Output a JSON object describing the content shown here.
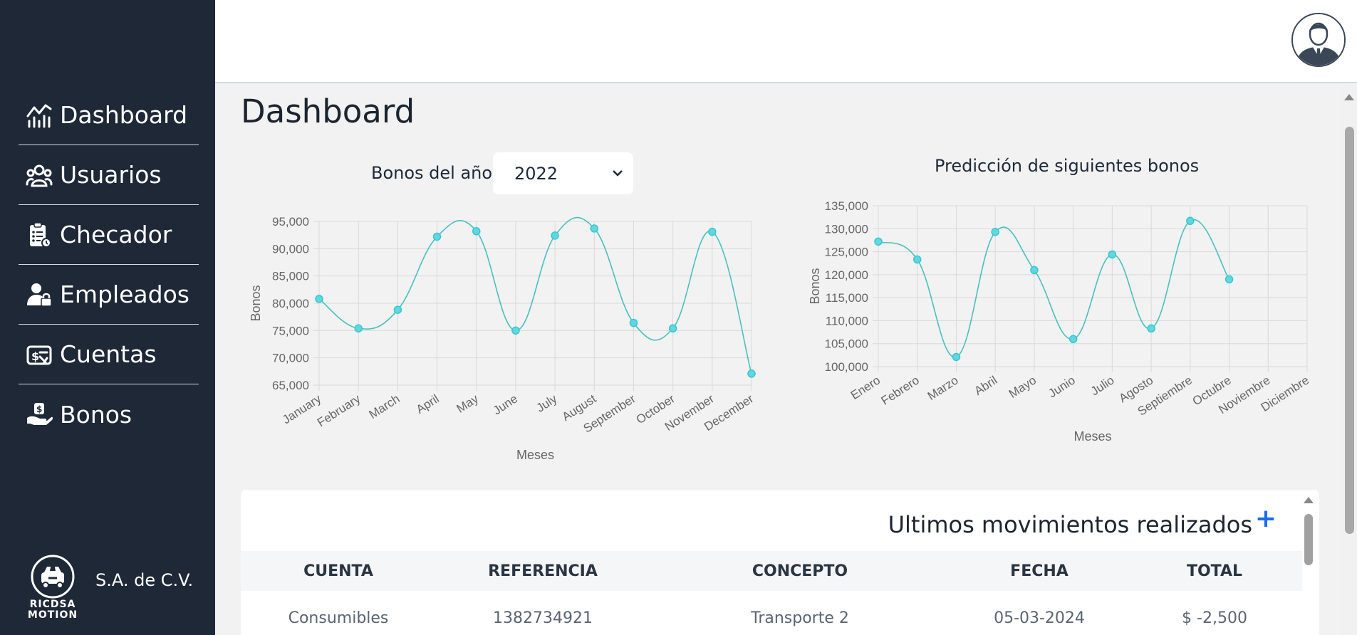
{
  "sidebar": {
    "items": [
      {
        "label": "Dashboard",
        "icon": "dashboard-chart-icon"
      },
      {
        "label": "Usuarios",
        "icon": "users-icon"
      },
      {
        "label": "Checador",
        "icon": "clipboard-check-icon"
      },
      {
        "label": "Empleados",
        "icon": "employee-lock-icon"
      },
      {
        "label": "Cuentas",
        "icon": "money-check-icon"
      },
      {
        "label": "Bonos",
        "icon": "hand-money-icon"
      }
    ],
    "brand_logo_text": [
      "RICDSA",
      "MOTION"
    ],
    "company_suffix": "S.A. de C.V."
  },
  "header": {
    "avatar_icon": "user-avatar-icon"
  },
  "main": {
    "title": "Dashboard",
    "year_label": "Bonos del año",
    "year_selected": "2022",
    "prediction_title": "Predicción de siguientes bonos"
  },
  "chart_data": [
    {
      "type": "line",
      "title": "",
      "xlabel": "Meses",
      "ylabel": "Bonos",
      "categories": [
        "January",
        "February",
        "March",
        "April",
        "May",
        "June",
        "July",
        "August",
        "September",
        "October",
        "November",
        "December"
      ],
      "values": [
        80800,
        75400,
        78800,
        92200,
        93200,
        75000,
        92400,
        93700,
        76400,
        75400,
        93100,
        67100
      ],
      "ylim": [
        65000,
        95000
      ],
      "yticks": [
        "95,000",
        "90,000",
        "85,000",
        "80,000",
        "75,000",
        "70,000",
        "65,000"
      ],
      "grid": true,
      "color": "#4bc0c0"
    },
    {
      "type": "line",
      "title": "Predicción de siguientes bonos",
      "xlabel": "Meses",
      "ylabel": "Bonos",
      "categories": [
        "Enero",
        "Febrero",
        "Marzo",
        "Abril",
        "Mayo",
        "Junio",
        "Julio",
        "Agosto",
        "Septiembre",
        "Octubre",
        "Noviembre",
        "Diciembre"
      ],
      "values": [
        127200,
        123300,
        102100,
        129300,
        121000,
        106000,
        124400,
        108300,
        131700,
        119000,
        null,
        null
      ],
      "ylim": [
        100000,
        135000
      ],
      "yticks": [
        "135,000",
        "130,000",
        "125,000",
        "120,000",
        "115,000",
        "110,000",
        "105,000",
        "100,000"
      ],
      "grid": true,
      "color": "#4bc0c0"
    }
  ],
  "movements": {
    "title": "Ultimos movimientos realizados",
    "add_label": "+",
    "columns": [
      "CUENTA",
      "REFERENCIA",
      "CONCEPTO",
      "FECHA",
      "TOTAL"
    ],
    "rows": [
      [
        "Consumibles",
        "1382734921",
        "Transporte 2",
        "05-03-2024",
        "$ -2,500"
      ]
    ]
  }
}
